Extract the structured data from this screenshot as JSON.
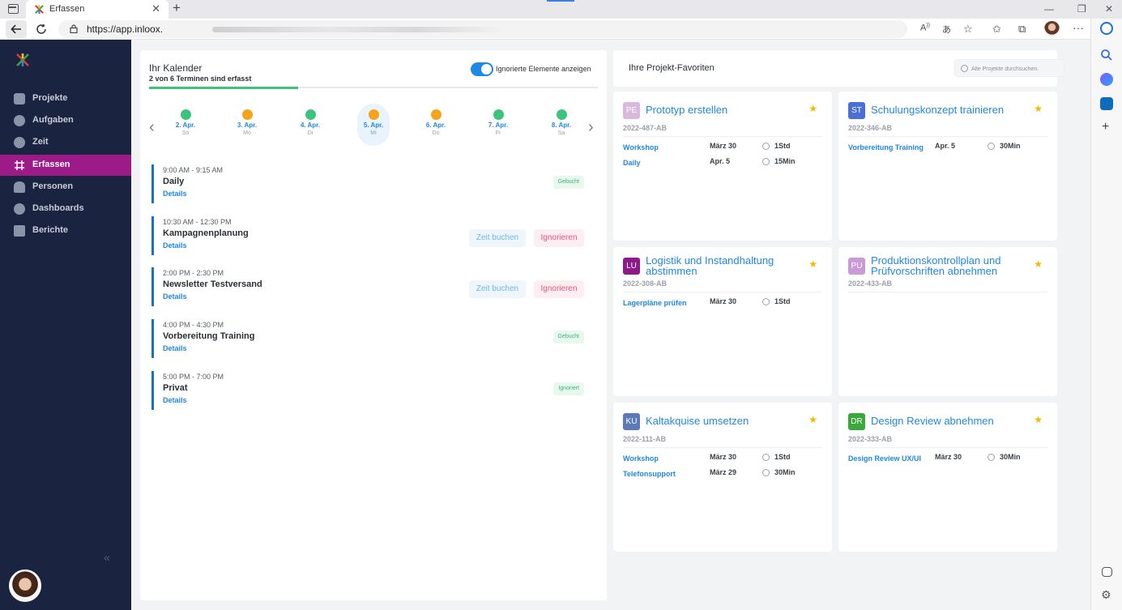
{
  "browser": {
    "tab_title": "Erfassen",
    "url": "https://app.inloox.",
    "new_tab": "+",
    "tab_close": "✕",
    "win_minimize": "—",
    "win_restore": "❐",
    "win_close": "✕"
  },
  "sidebar": {
    "items": [
      {
        "label": "Projekte",
        "icon": "folder-icon"
      },
      {
        "label": "Aufgaben",
        "icon": "check-circle-icon"
      },
      {
        "label": "Zeit",
        "icon": "clock-icon"
      },
      {
        "label": "Erfassen",
        "icon": "track-icon",
        "active": true
      },
      {
        "label": "Personen",
        "icon": "people-icon"
      },
      {
        "label": "Dashboards",
        "icon": "pie-chart-icon"
      },
      {
        "label": "Berichte",
        "icon": "report-icon"
      }
    ],
    "collapse_glyph": "«",
    "accent": "#9c1b88"
  },
  "calendar": {
    "title": "Ihr Kalender",
    "subtitle": "2 von 6 Terminen sind erfasst",
    "progress": 0.333,
    "toggle_label": "Ignorierte Elemente anzeigen",
    "toggle_on": true,
    "prev_glyph": "‹",
    "next_glyph": "›",
    "days": [
      {
        "date": "2. Apr.",
        "weekday": "So",
        "status": "green"
      },
      {
        "date": "3. Apr.",
        "weekday": "Mo",
        "status": "orange"
      },
      {
        "date": "4. Apr.",
        "weekday": "Di",
        "status": "green"
      },
      {
        "date": "5. Apr.",
        "weekday": "Mi",
        "status": "orange",
        "selected": true
      },
      {
        "date": "6. Apr.",
        "weekday": "Do",
        "status": "orange"
      },
      {
        "date": "7. Apr.",
        "weekday": "Fr",
        "status": "green"
      },
      {
        "date": "8. Apr.",
        "weekday": "Sa",
        "status": "green"
      }
    ],
    "events": [
      {
        "time": "9:00 AM - 9:15 AM",
        "name": "Daily",
        "details": "Details",
        "status": "Gebucht"
      },
      {
        "time": "10:30 AM - 12:30 PM",
        "name": "Kampagnenplanung",
        "details": "Details",
        "book": "Zeit buchen",
        "ignore": "Ignorieren"
      },
      {
        "time": "2:00 PM - 2:30 PM",
        "name": "Newsletter Testversand",
        "details": "Details",
        "book": "Zeit buchen",
        "ignore": "Ignorieren"
      },
      {
        "time": "4:00 PM - 4:30 PM",
        "name": "Vorbereitung Training",
        "details": "Details",
        "status": "Gebucht"
      },
      {
        "time": "5:00 PM - 7:00 PM",
        "name": "Privat",
        "details": "Details",
        "status": "Ignoriert"
      }
    ]
  },
  "favorites": {
    "title": "Ihre Projekt-Favoriten",
    "search_placeholder": "Alle Projekte durchsuchen.",
    "star": "★",
    "projects": [
      {
        "abbr": "PE",
        "color": "#d9b8dc",
        "title": "Prototyp erstellen",
        "code": "2022-487-AB",
        "rows": [
          {
            "activity": "Workshop",
            "date": "März 30",
            "duration": "1Std"
          },
          {
            "activity": "Daily",
            "date": "Apr. 5",
            "duration": "15Min"
          }
        ]
      },
      {
        "abbr": "ST",
        "color": "#4a6fd6",
        "title": "Schulungskonzept trainieren",
        "code": "2022-346-AB",
        "rows": [
          {
            "activity": "Vorbereitung Training",
            "date": "Apr. 5",
            "duration": "30Min"
          }
        ]
      },
      {
        "abbr": "LU",
        "color": "#8e1a8a",
        "title": "Logistik und Instandhaltung abstimmen",
        "code": "2022-308-AB",
        "rows": [
          {
            "activity": "Lagerpläne prüfen",
            "date": "März 30",
            "duration": "1Std"
          }
        ]
      },
      {
        "abbr": "PU",
        "color": "#c89ad6",
        "title": "Produktionskontrollplan und Prüfvorschriften abnehmen",
        "code": "2022-433-AB",
        "rows": []
      },
      {
        "abbr": "KU",
        "color": "#5a7bb8",
        "title": "Kaltakquise umsetzen",
        "code": "2022-111-AB",
        "rows": [
          {
            "activity": "Workshop",
            "date": "März 30",
            "duration": "1Std"
          },
          {
            "activity": "Telefonsupport",
            "date": "März 29",
            "duration": "30Min"
          }
        ]
      },
      {
        "abbr": "DR",
        "color": "#3aa83a",
        "title": "Design Review abnehmen",
        "code": "2022-333-AB",
        "rows": [
          {
            "activity": "Design Review UX/UI",
            "date": "März 30",
            "duration": "30Min"
          }
        ]
      }
    ]
  },
  "colors": {
    "green": "#3cc47c",
    "orange": "#f5a31a",
    "link": "#1e88e5",
    "sidebar_bg": "#1a2340"
  }
}
